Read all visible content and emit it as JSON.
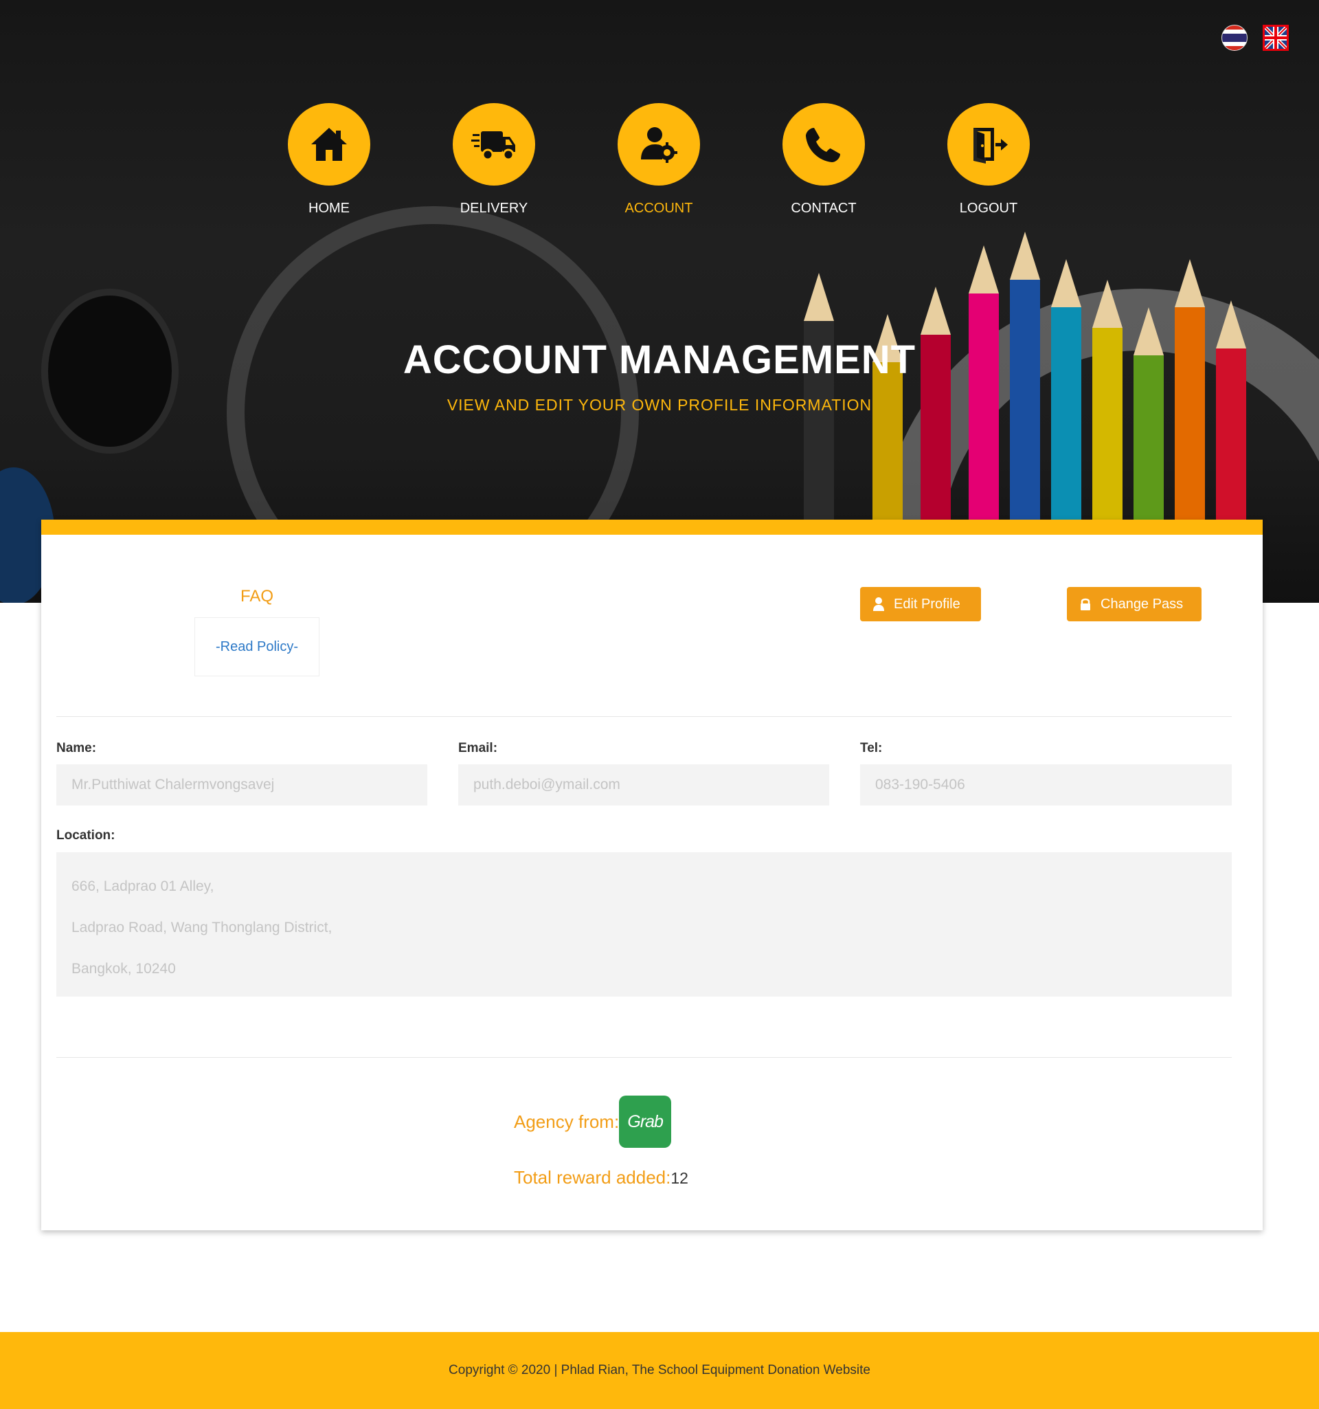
{
  "languages": [
    {
      "name": "thai-flag-icon"
    },
    {
      "name": "uk-flag-icon"
    }
  ],
  "nav": {
    "home": "HOME",
    "delivery": "DELIVERY",
    "account": "ACCOUNT",
    "contact": "CONTACT",
    "logout": "LOGOUT",
    "active": "ACCOUNT"
  },
  "hero": {
    "title": "ACCOUNT MANAGEMENT",
    "subtitle": "VIEW AND EDIT YOUR OWN PROFILE INFORMATION"
  },
  "faq": {
    "title": "FAQ",
    "link": "-Read Policy-"
  },
  "buttons": {
    "edit_profile": "Edit Profile",
    "change_pass": "Change Pass"
  },
  "profile": {
    "name_label": "Name:",
    "name_value": "Mr.Putthiwat Chalermvongsavej",
    "email_label": "Email:",
    "email_value": "puth.deboi@ymail.com",
    "tel_label": "Tel:",
    "tel_value": "083-190-5406",
    "location_label": "Location:",
    "location_lines": [
      "666, Ladprao 01 Alley,",
      "Ladprao Road, Wang Thonglang District,",
      "Bangkok, 10240"
    ]
  },
  "agency": {
    "label": "Agency from:",
    "logo_text": "Grab"
  },
  "reward": {
    "label": "Total reward added:",
    "value": "12"
  },
  "footer": {
    "text": "Copyright © 2020 | Phlad Rian, The School Equipment Donation Website"
  },
  "colors": {
    "accent": "#ffb80c",
    "button": "#f29d16",
    "link": "#2d79c7",
    "grab": "#2ea04e"
  }
}
